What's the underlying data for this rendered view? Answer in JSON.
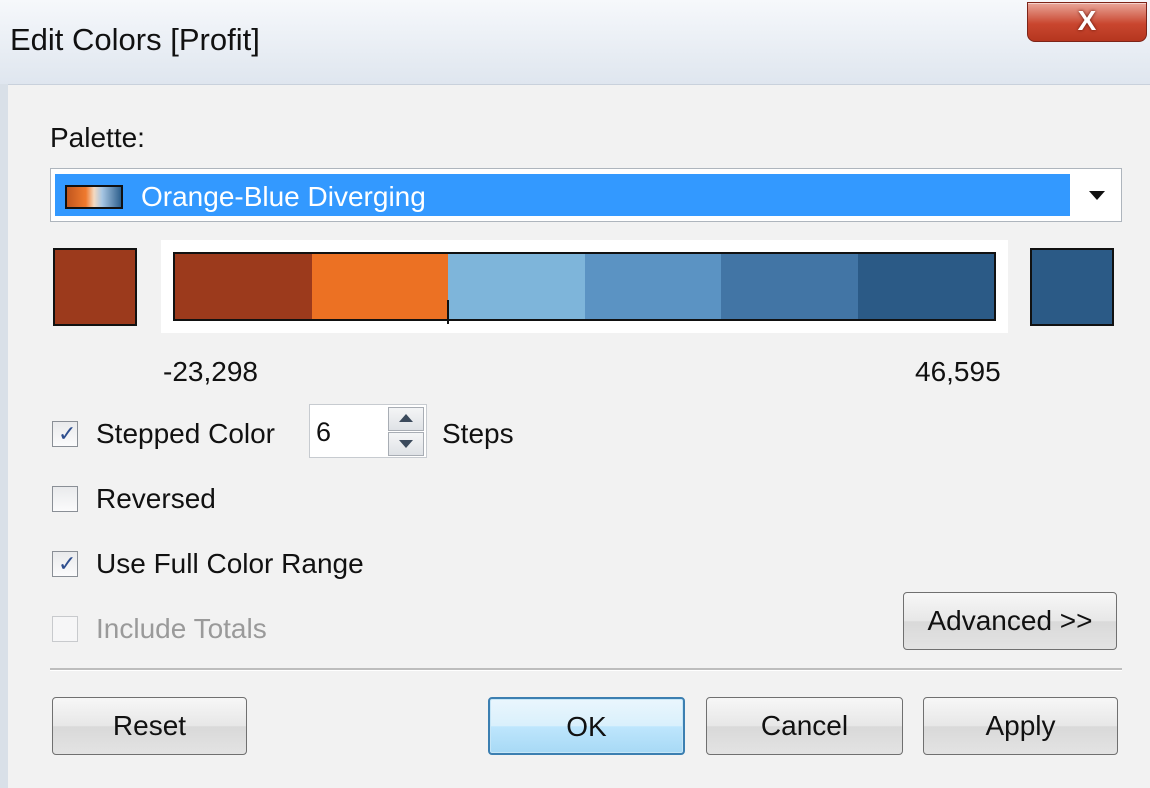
{
  "dialog": {
    "title": "Edit Colors [Profit]",
    "close_glyph": "X"
  },
  "palette": {
    "label": "Palette:",
    "selected": "Orange-Blue Diverging"
  },
  "color_ramp": {
    "start_color": "#9c3a1c",
    "end_color": "#2b5a86",
    "steps": [
      "#9c3a1c",
      "#ec7123",
      "#7eb5da",
      "#5b93c3",
      "#4275a5",
      "#2b5a86"
    ],
    "min_label": "-23,298",
    "max_label": "46,595"
  },
  "options": {
    "stepped_color": {
      "label": "Stepped Color",
      "checked": true
    },
    "steps_value": "6",
    "steps_label": "Steps",
    "reversed": {
      "label": "Reversed",
      "checked": false
    },
    "use_full_range": {
      "label": "Use Full Color Range",
      "checked": true
    },
    "include_totals": {
      "label": "Include Totals",
      "checked": false,
      "disabled": true
    }
  },
  "buttons": {
    "advanced": "Advanced >>",
    "reset": "Reset",
    "ok": "OK",
    "cancel": "Cancel",
    "apply": "Apply"
  },
  "colors": {
    "selection_highlight": "#3399ff",
    "close_button": "#c9462f"
  }
}
